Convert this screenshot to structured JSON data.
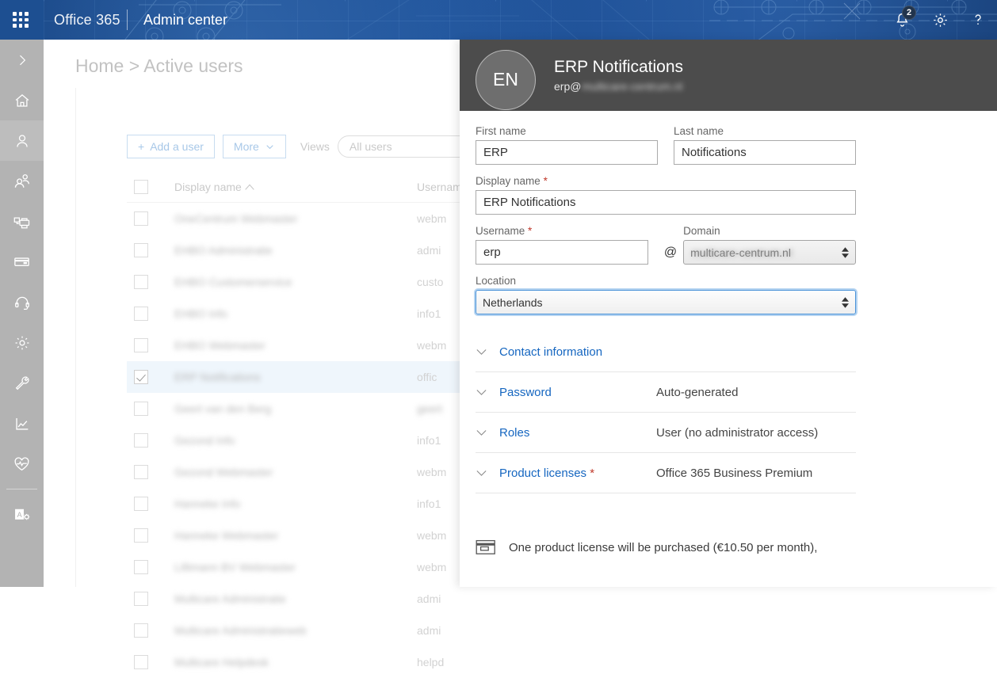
{
  "header": {
    "waffle_icon": "app-launcher-icon",
    "brand": "Office 365",
    "app_name": "Admin center",
    "notifications_icon": "bell-icon",
    "notifications_count": "2",
    "settings_icon": "gear-icon",
    "help_icon": "help-icon"
  },
  "rail": {
    "items": [
      {
        "name": "expand-nav",
        "icon": "chevron-right-icon"
      },
      {
        "name": "home",
        "icon": "home-icon"
      },
      {
        "name": "users",
        "icon": "person-icon"
      },
      {
        "name": "groups",
        "icon": "people-icon"
      },
      {
        "name": "resources",
        "icon": "printer-icon"
      },
      {
        "name": "billing",
        "icon": "credit-card-icon"
      },
      {
        "name": "support",
        "icon": "headset-icon"
      },
      {
        "name": "settings",
        "icon": "gear-icon"
      },
      {
        "name": "setup",
        "icon": "wrench-icon"
      },
      {
        "name": "reports",
        "icon": "chart-icon"
      },
      {
        "name": "health",
        "icon": "heart-pulse-icon"
      },
      {
        "name": "admin-centers",
        "icon": "admin-a-icon"
      }
    ]
  },
  "main": {
    "breadcrumb": "Home > Active users",
    "add_user_label": "Add a user",
    "add_user_plus": "+",
    "more_label": "More",
    "views_label": "Views",
    "views_value": "All users",
    "table": {
      "columns": [
        "Display name",
        "Username"
      ],
      "sort_column": "Display name",
      "sort_direction": "ascending",
      "rows": [
        {
          "display_name": "OneCentrum Webmaster",
          "username": "webm",
          "selected": false
        },
        {
          "display_name": "EHBO Administratie",
          "username": "admi",
          "selected": false
        },
        {
          "display_name": "EHBO Customerservice",
          "username": "custo",
          "selected": false
        },
        {
          "display_name": "EHBO Info",
          "username": "info1",
          "selected": false
        },
        {
          "display_name": "EHBO Webmaster",
          "username": "webm",
          "selected": false
        },
        {
          "display_name": "ERP Notifications",
          "username": "offic",
          "selected": true
        },
        {
          "display_name": "Geert van den Berg",
          "username": "geert",
          "selected": false
        },
        {
          "display_name": "Gezond Info",
          "username": "info1",
          "selected": false
        },
        {
          "display_name": "Gezond Webmaster",
          "username": "webm",
          "selected": false
        },
        {
          "display_name": "Hanneke Info",
          "username": "info1",
          "selected": false
        },
        {
          "display_name": "Hanneke Webmaster",
          "username": "webm",
          "selected": false
        },
        {
          "display_name": "Lillimann BV Webmaster",
          "username": "webm",
          "selected": false
        },
        {
          "display_name": "Multicare Administratie",
          "username": "admi",
          "selected": false
        },
        {
          "display_name": "Multicare Administratieweb",
          "username": "admi",
          "selected": false
        },
        {
          "display_name": "Multicare Helpdesk",
          "username": "helpd",
          "selected": false
        }
      ]
    }
  },
  "panel": {
    "avatar_initials": "EN",
    "title": "ERP Notifications",
    "email_user": "erp@",
    "email_domain": "multicare-centrum.nl",
    "fields": {
      "first_name_label": "First name",
      "first_name_value": "ERP",
      "last_name_label": "Last name",
      "last_name_value": "Notifications",
      "display_name_label": "Display name",
      "display_name_value": "ERP Notifications",
      "username_label": "Username",
      "username_value": "erp",
      "at": "@",
      "domain_label": "Domain",
      "domain_value": "multicare-centrum.nl",
      "location_label": "Location",
      "location_value": "Netherlands",
      "required_marker": "*"
    },
    "sections": [
      {
        "label": "Contact information",
        "value": "",
        "required": false
      },
      {
        "label": "Password",
        "value": "Auto-generated",
        "required": false
      },
      {
        "label": "Roles",
        "value": "User (no administrator access)",
        "required": false
      },
      {
        "label": "Product licenses",
        "value": "Office 365 Business Premium",
        "required": true
      }
    ],
    "purchase_icon": "credit-card-icon",
    "purchase_note": "One product license will be purchased (€10.50 per month),"
  },
  "colors": {
    "header_blue": "#1a4a8d",
    "link_blue": "#1566c0",
    "panel_header_gray": "#4c4c4c",
    "selected_row": "#eff6fc",
    "required_red": "#c0392b"
  }
}
